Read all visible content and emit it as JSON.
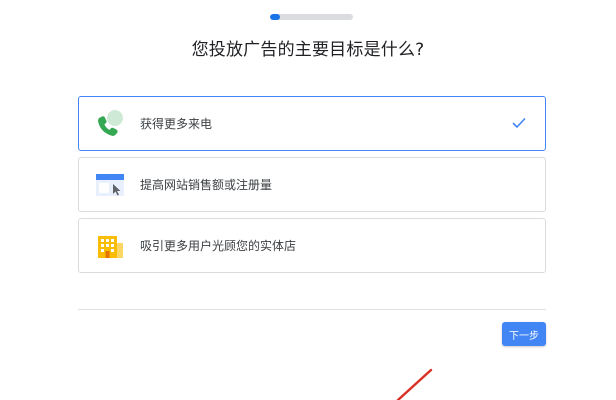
{
  "progress": {
    "fraction": 0.12,
    "accent_color": "#1a73e8",
    "track_color": "#dadce0"
  },
  "title": "您投放广告的主要目标是什么?",
  "options": [
    {
      "label": "获得更多来电",
      "icon": "phone-call-icon",
      "selected": true
    },
    {
      "label": "提高网站销售额或注册量",
      "icon": "website-click-icon",
      "selected": false
    },
    {
      "label": "吸引更多用户光顾您的实体店",
      "icon": "storefront-building-icon",
      "selected": false
    }
  ],
  "selected_check_icon": "checkmark-icon",
  "next_button": {
    "label": "下一步",
    "color": "#4285f4"
  },
  "colors": {
    "selected_border": "#4285f4",
    "annotation": "#d93025"
  }
}
